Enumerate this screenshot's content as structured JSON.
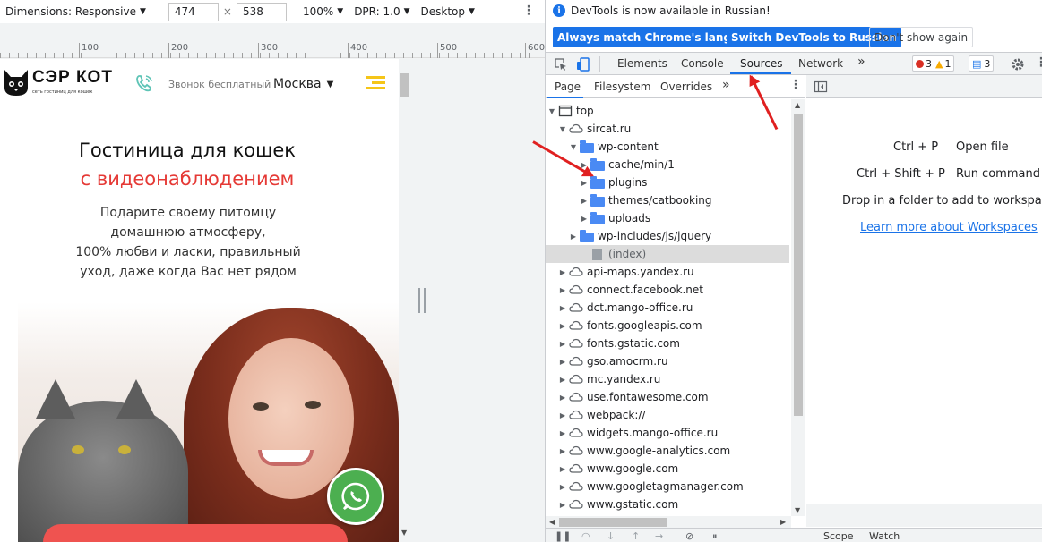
{
  "device_toolbar": {
    "dimensions_label": "Dimensions: Responsive",
    "width": "474",
    "times": "×",
    "height": "538",
    "zoom": "100%",
    "dpr": "DPR: 1.0",
    "mode": "Desktop"
  },
  "ruler": {
    "labels": [
      "100",
      "200",
      "300",
      "400",
      "500",
      "600"
    ]
  },
  "site": {
    "logo_name": "СЭР КОТ",
    "logo_tagline": "сеть гостиниц для кошек",
    "call_free": "Звонок бесплатный",
    "city": "Москва",
    "hero_line1": "Гостиница для кошек",
    "hero_line2": "с видеонаблюдением",
    "hero_text": [
      "Подарите своему питомцу",
      "домашнюю атмосферу,",
      "100% любви и ласки, правильный",
      "уход, даже когда Вас нет рядом"
    ]
  },
  "infobar": {
    "message": "DevTools is now available in Russian!",
    "btn_match": "Always match Chrome's language",
    "btn_switch": "Switch DevTools to Russian",
    "btn_dismiss": "Don't show again"
  },
  "tabs": {
    "elements": "Elements",
    "console": "Console",
    "sources": "Sources",
    "network": "Network",
    "more": "»",
    "errors": "3",
    "warnings": "1",
    "messages": "3"
  },
  "navigator": {
    "tab_page": "Page",
    "tab_filesystem": "Filesystem",
    "tab_overrides": "Overrides",
    "tab_more": "»",
    "tree": [
      {
        "label": "top"
      },
      {
        "label": "sircat.ru"
      },
      {
        "label": "wp-content"
      },
      {
        "label": "cache/min/1"
      },
      {
        "label": "plugins"
      },
      {
        "label": "themes/catbooking"
      },
      {
        "label": "uploads"
      },
      {
        "label": "wp-includes/js/jquery"
      },
      {
        "label": "(index)"
      },
      {
        "label": "api-maps.yandex.ru"
      },
      {
        "label": "connect.facebook.net"
      },
      {
        "label": "dct.mango-office.ru"
      },
      {
        "label": "fonts.googleapis.com"
      },
      {
        "label": "fonts.gstatic.com"
      },
      {
        "label": "gso.amocrm.ru"
      },
      {
        "label": "mc.yandex.ru"
      },
      {
        "label": "use.fontawesome.com"
      },
      {
        "label": "webpack://"
      },
      {
        "label": "widgets.mango-office.ru"
      },
      {
        "label": "www.google-analytics.com"
      },
      {
        "label": "www.google.com"
      },
      {
        "label": "www.googletagmanager.com"
      },
      {
        "label": "www.gstatic.com"
      }
    ]
  },
  "editor": {
    "open_file_keys": "Ctrl + P",
    "open_file": "Open file",
    "run_command_keys": "Ctrl + Shift + P",
    "run_command": "Run command",
    "drop_hint": "Drop in a folder to add to workspace",
    "learn_more": "Learn more about Workspaces"
  },
  "bottom": {
    "scope": "Scope",
    "watch": "Watch"
  },
  "colors": {
    "accent": "#1a73e8",
    "annotation_arrow": "#e02020",
    "brand_red": "#e53935",
    "brand_yellow": "#f5c518"
  }
}
